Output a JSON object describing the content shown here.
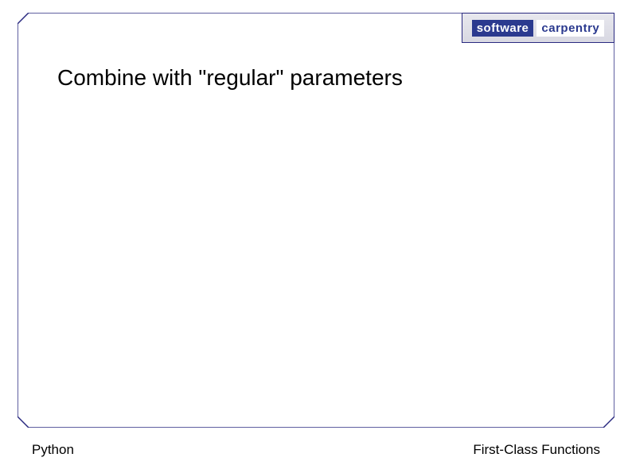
{
  "slide": {
    "title": "Combine with \"regular\" parameters"
  },
  "logo": {
    "word1": "software",
    "word2": "carpentry"
  },
  "footer": {
    "left": "Python",
    "right": "First-Class Functions"
  },
  "colors": {
    "border": "#2a2a80",
    "logo_bg": "#2b3a8f"
  }
}
